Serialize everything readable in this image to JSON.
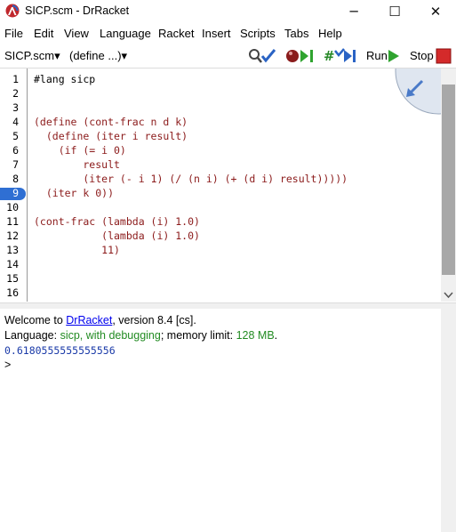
{
  "window": {
    "title": "SICP.scm - DrRacket",
    "minimize": "─",
    "maximize": "☐",
    "close": "✕"
  },
  "menu": [
    "File",
    "Edit",
    "View",
    "Language",
    "Racket",
    "Insert",
    "Scripts",
    "Tabs",
    "Help"
  ],
  "toolbar": {
    "file_dropdown": "SICP.scm▾",
    "define_dropdown": "(define ...)▾",
    "run_label": "Run",
    "stop_label": "Stop"
  },
  "editor": {
    "line_numbers": [
      "1",
      "2",
      "3",
      "4",
      "5",
      "6",
      "7",
      "8",
      "9",
      "10",
      "11",
      "12",
      "13",
      "14",
      "15",
      "16"
    ],
    "breakpoint_line": "9",
    "lines": [
      "#lang sicp",
      "",
      "",
      "(define (cont-frac n d k)",
      "  (define (iter i result)",
      "    (if (= i 0)",
      "        result",
      "        (iter (- i 1) (/ (n i) (+ (d i) result)))))",
      "  (iter k 0))",
      "",
      "(cont-frac (lambda (i) 1.0)",
      "           (lambda (i) 1.0)",
      "           11)",
      "",
      "",
      ""
    ]
  },
  "repl": {
    "welcome_prefix": "Welcome to ",
    "welcome_link": "DrRacket",
    "welcome_suffix": ", version 8.4 [cs].",
    "language_prefix": "Language: ",
    "language_value": "sicp, with debugging",
    "memory_prefix": "; memory limit: ",
    "memory_value": "128 MB",
    "memory_suffix": ".",
    "result": "0.6180555555555556",
    "prompt": ">"
  },
  "colors": {
    "code": "#8b1a1a",
    "breakpoint": "#2f6fd3",
    "link": "#0000ee",
    "language_green": "#228b22",
    "result_blue": "#1a3aa8"
  }
}
